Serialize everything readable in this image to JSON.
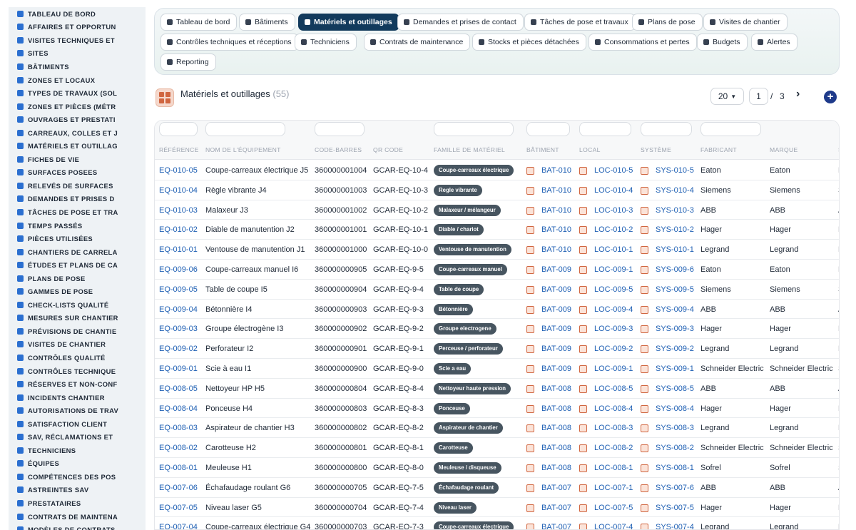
{
  "sidebar": {
    "items": [
      {
        "label": "Tableau de bord",
        "icon": "dashboard-icon"
      },
      {
        "label": "Affaires et opportun",
        "icon": "target-icon"
      },
      {
        "label": "Visites techniques et",
        "icon": "eye-icon"
      },
      {
        "label": "Sites",
        "icon": "map-pin-icon"
      },
      {
        "label": "Bâtiments",
        "icon": "building-icon"
      },
      {
        "label": "Zones et locaux",
        "icon": "layers-icon"
      },
      {
        "label": "Types de travaux (sol",
        "icon": "sitemap-icon"
      },
      {
        "label": "Zones et pièces (métr",
        "icon": "grid-icon"
      },
      {
        "label": "Ouvrages et prestati",
        "icon": "ruler-icon"
      },
      {
        "label": "Carreaux, colles et j",
        "icon": "tiles-icon"
      },
      {
        "label": "Matériels et outillag",
        "icon": "tools-icon"
      },
      {
        "label": "Fiches de vie",
        "icon": "file-icon"
      },
      {
        "label": "Surfaces posees",
        "icon": "history-icon"
      },
      {
        "label": "Relevés de surfaces",
        "icon": "measure-icon"
      },
      {
        "label": "Demandes et prises d",
        "icon": "inbox-icon"
      },
      {
        "label": "Tâches de pose et tra",
        "icon": "tasks-icon"
      },
      {
        "label": "Temps passés",
        "icon": "clock-icon"
      },
      {
        "label": "Pièces utilisées",
        "icon": "box-icon"
      },
      {
        "label": "Chantiers de carrela",
        "icon": "hammer-icon"
      },
      {
        "label": "Études et plans de ca",
        "icon": "pencil-icon"
      },
      {
        "label": "Plans de pose",
        "icon": "map-icon"
      },
      {
        "label": "Gammes de pose",
        "icon": "list-icon"
      },
      {
        "label": "Check-lists qualité",
        "icon": "checklist-icon"
      },
      {
        "label": "Mesures sur chantier",
        "icon": "gauge-icon"
      },
      {
        "label": "Prévisions de chantie",
        "icon": "calendar-icon"
      },
      {
        "label": "Visites de chantier",
        "icon": "walk-icon"
      },
      {
        "label": "Contrôles qualité",
        "icon": "shield-check-icon"
      },
      {
        "label": "Contrôles technique",
        "icon": "clipboard-icon"
      },
      {
        "label": "Réserves et non-conf",
        "icon": "warning-icon"
      },
      {
        "label": "Incidents chantier",
        "icon": "alert-icon"
      },
      {
        "label": "Autorisations de trav",
        "icon": "key-icon"
      },
      {
        "label": "Satisfaction client",
        "icon": "smile-icon"
      },
      {
        "label": "SAV, réclamations et",
        "icon": "chat-icon"
      },
      {
        "label": "Techniciens",
        "icon": "hardhat-icon"
      },
      {
        "label": "Équipes",
        "icon": "users-icon"
      },
      {
        "label": "Compétences des pos",
        "icon": "star-icon"
      },
      {
        "label": "Astreintes SAV",
        "icon": "phone-icon"
      },
      {
        "label": "Prestataires",
        "icon": "truck-icon"
      },
      {
        "label": "Contrats de maintena",
        "icon": "contract-icon"
      },
      {
        "label": "Modèles de contrats",
        "icon": "template-icon"
      }
    ]
  },
  "tabs": [
    {
      "label": "Tableau de bord",
      "icon": "dashboard-icon",
      "active": false
    },
    {
      "label": "Bâtiments",
      "icon": "building-icon",
      "active": false
    },
    {
      "label": "Matériels et outillages",
      "icon": "tools-icon",
      "active": true
    },
    {
      "label": "Demandes et prises de contact",
      "icon": "question-icon",
      "active": false
    },
    {
      "label": "Tâches de pose et travaux",
      "icon": "tasks-icon",
      "active": false
    },
    {
      "label": "Plans de pose",
      "icon": "calendar-icon",
      "active": false
    },
    {
      "label": "Visites de chantier",
      "icon": "walk-icon",
      "active": false
    },
    {
      "label": "Contrôles techniques et réceptions",
      "icon": "clipboard-icon",
      "active": false
    },
    {
      "label": "Techniciens",
      "icon": "hardhat-icon",
      "active": false
    },
    {
      "label": "Contrats de maintenance",
      "icon": "contract-icon",
      "active": false
    },
    {
      "label": "Stocks et pièces détachées",
      "icon": "boxes-icon",
      "active": false
    },
    {
      "label": "Consommations et pertes",
      "icon": "bolt-icon",
      "active": false
    },
    {
      "label": "Budgets",
      "icon": "money-icon",
      "active": false
    },
    {
      "label": "Alertes",
      "icon": "bell-icon",
      "active": false
    },
    {
      "label": "Reporting",
      "icon": "chart-pie-icon",
      "active": false
    }
  ],
  "header": {
    "title": "Matériels et outillages",
    "count": "(55)",
    "page_size": "20",
    "current_page": "1",
    "page_separator": "/",
    "total_pages": "3"
  },
  "table": {
    "columns": [
      "Référence",
      "Nom de l'équipement",
      "Code-barres",
      "QR code",
      "Famille de matériel",
      "Bâtiment",
      "Local",
      "Système",
      "Fabricant",
      "Marque",
      "S"
    ],
    "rows": [
      {
        "ref": "EQ-010-05",
        "name": "Coupe-carreaux électrique J5",
        "barcode": "360000001004",
        "qr": "GCAR-EQ-10-4",
        "family": "Coupe-carreaux électrique",
        "building": "BAT-010",
        "local": "LOC-010-5",
        "system": "SYS-010-5",
        "maker": "Eaton",
        "brand": "Eaton",
        "extra": "E"
      },
      {
        "ref": "EQ-010-04",
        "name": "Règle vibrante J4",
        "barcode": "360000001003",
        "qr": "GCAR-EQ-10-3",
        "family": "Regle vibrante",
        "building": "BAT-010",
        "local": "LOC-010-4",
        "system": "SYS-010-4",
        "maker": "Siemens",
        "brand": "Siemens",
        "extra": "S"
      },
      {
        "ref": "EQ-010-03",
        "name": "Malaxeur J3",
        "barcode": "360000001002",
        "qr": "GCAR-EQ-10-2",
        "family": "Malaxeur / mélangeur",
        "building": "BAT-010",
        "local": "LOC-010-3",
        "system": "SYS-010-3",
        "maker": "ABB",
        "brand": "ABB",
        "extra": "A"
      },
      {
        "ref": "EQ-010-02",
        "name": "Diable de manutention J2",
        "barcode": "360000001001",
        "qr": "GCAR-EQ-10-1",
        "family": "Diable / chariot",
        "building": "BAT-010",
        "local": "LOC-010-2",
        "system": "SYS-010-2",
        "maker": "Hager",
        "brand": "Hager",
        "extra": "H"
      },
      {
        "ref": "EQ-010-01",
        "name": "Ventouse de manutention J1",
        "barcode": "360000001000",
        "qr": "GCAR-EQ-10-0",
        "family": "Ventouse de manutention",
        "building": "BAT-010",
        "local": "LOC-010-1",
        "system": "SYS-010-1",
        "maker": "Legrand",
        "brand": "Legrand",
        "extra": "L"
      },
      {
        "ref": "EQ-009-06",
        "name": "Coupe-carreaux manuel I6",
        "barcode": "360000000905",
        "qr": "GCAR-EQ-9-5",
        "family": "Coupe-carreaux manuel",
        "building": "BAT-009",
        "local": "LOC-009-1",
        "system": "SYS-009-6",
        "maker": "Eaton",
        "brand": "Eaton",
        "extra": "E"
      },
      {
        "ref": "EQ-009-05",
        "name": "Table de coupe I5",
        "barcode": "360000000904",
        "qr": "GCAR-EQ-9-4",
        "family": "Table de coupe",
        "building": "BAT-009",
        "local": "LOC-009-5",
        "system": "SYS-009-5",
        "maker": "Siemens",
        "brand": "Siemens",
        "extra": "S"
      },
      {
        "ref": "EQ-009-04",
        "name": "Bétonnière I4",
        "barcode": "360000000903",
        "qr": "GCAR-EQ-9-3",
        "family": "Bétonnière",
        "building": "BAT-009",
        "local": "LOC-009-4",
        "system": "SYS-009-4",
        "maker": "ABB",
        "brand": "ABB",
        "extra": "A"
      },
      {
        "ref": "EQ-009-03",
        "name": "Groupe électrogène I3",
        "barcode": "360000000902",
        "qr": "GCAR-EQ-9-2",
        "family": "Groupe electrogene",
        "building": "BAT-009",
        "local": "LOC-009-3",
        "system": "SYS-009-3",
        "maker": "Hager",
        "brand": "Hager",
        "extra": "H"
      },
      {
        "ref": "EQ-009-02",
        "name": "Perforateur I2",
        "barcode": "360000000901",
        "qr": "GCAR-EQ-9-1",
        "family": "Perceuse / perforateur",
        "building": "BAT-009",
        "local": "LOC-009-2",
        "system": "SYS-009-2",
        "maker": "Legrand",
        "brand": "Legrand",
        "extra": "L"
      },
      {
        "ref": "EQ-009-01",
        "name": "Scie à eau I1",
        "barcode": "360000000900",
        "qr": "GCAR-EQ-9-0",
        "family": "Scie a eau",
        "building": "BAT-009",
        "local": "LOC-009-1",
        "system": "SYS-009-1",
        "maker": "Schneider Electric",
        "brand": "Schneider Electric",
        "extra": "S"
      },
      {
        "ref": "EQ-008-05",
        "name": "Nettoyeur HP H5",
        "barcode": "360000000804",
        "qr": "GCAR-EQ-8-4",
        "family": "Nettoyeur haute pression",
        "building": "BAT-008",
        "local": "LOC-008-5",
        "system": "SYS-008-5",
        "maker": "ABB",
        "brand": "ABB",
        "extra": "A"
      },
      {
        "ref": "EQ-008-04",
        "name": "Ponceuse H4",
        "barcode": "360000000803",
        "qr": "GCAR-EQ-8-3",
        "family": "Ponceuse",
        "building": "BAT-008",
        "local": "LOC-008-4",
        "system": "SYS-008-4",
        "maker": "Hager",
        "brand": "Hager",
        "extra": "H"
      },
      {
        "ref": "EQ-008-03",
        "name": "Aspirateur de chantier H3",
        "barcode": "360000000802",
        "qr": "GCAR-EQ-8-2",
        "family": "Aspirateur de chantier",
        "building": "BAT-008",
        "local": "LOC-008-3",
        "system": "SYS-008-3",
        "maker": "Legrand",
        "brand": "Legrand",
        "extra": "L"
      },
      {
        "ref": "EQ-008-02",
        "name": "Carotteuse H2",
        "barcode": "360000000801",
        "qr": "GCAR-EQ-8-1",
        "family": "Carotteuse",
        "building": "BAT-008",
        "local": "LOC-008-2",
        "system": "SYS-008-2",
        "maker": "Schneider Electric",
        "brand": "Schneider Electric",
        "extra": "S"
      },
      {
        "ref": "EQ-008-01",
        "name": "Meuleuse H1",
        "barcode": "360000000800",
        "qr": "GCAR-EQ-8-0",
        "family": "Meuleuse / disqueuse",
        "building": "BAT-008",
        "local": "LOC-008-1",
        "system": "SYS-008-1",
        "maker": "Sofrel",
        "brand": "Sofrel",
        "extra": "S"
      },
      {
        "ref": "EQ-007-06",
        "name": "Échafaudage roulant G6",
        "barcode": "360000000705",
        "qr": "GCAR-EQ-7-5",
        "family": "Échafaudage roulant",
        "building": "BAT-007",
        "local": "LOC-007-1",
        "system": "SYS-007-6",
        "maker": "ABB",
        "brand": "ABB",
        "extra": "A"
      },
      {
        "ref": "EQ-007-05",
        "name": "Niveau laser G5",
        "barcode": "360000000704",
        "qr": "GCAR-EQ-7-4",
        "family": "Niveau laser",
        "building": "BAT-007",
        "local": "LOC-007-5",
        "system": "SYS-007-5",
        "maker": "Hager",
        "brand": "Hager",
        "extra": "H"
      },
      {
        "ref": "EQ-007-04",
        "name": "Coupe-carreaux électrique G4",
        "barcode": "360000000703",
        "qr": "GCAR-EQ-7-3",
        "family": "Coupe-carreaux électrique",
        "building": "BAT-007",
        "local": "LOC-007-4",
        "system": "SYS-007-4",
        "maker": "Legrand",
        "brand": "Legrand",
        "extra": "L"
      }
    ]
  }
}
